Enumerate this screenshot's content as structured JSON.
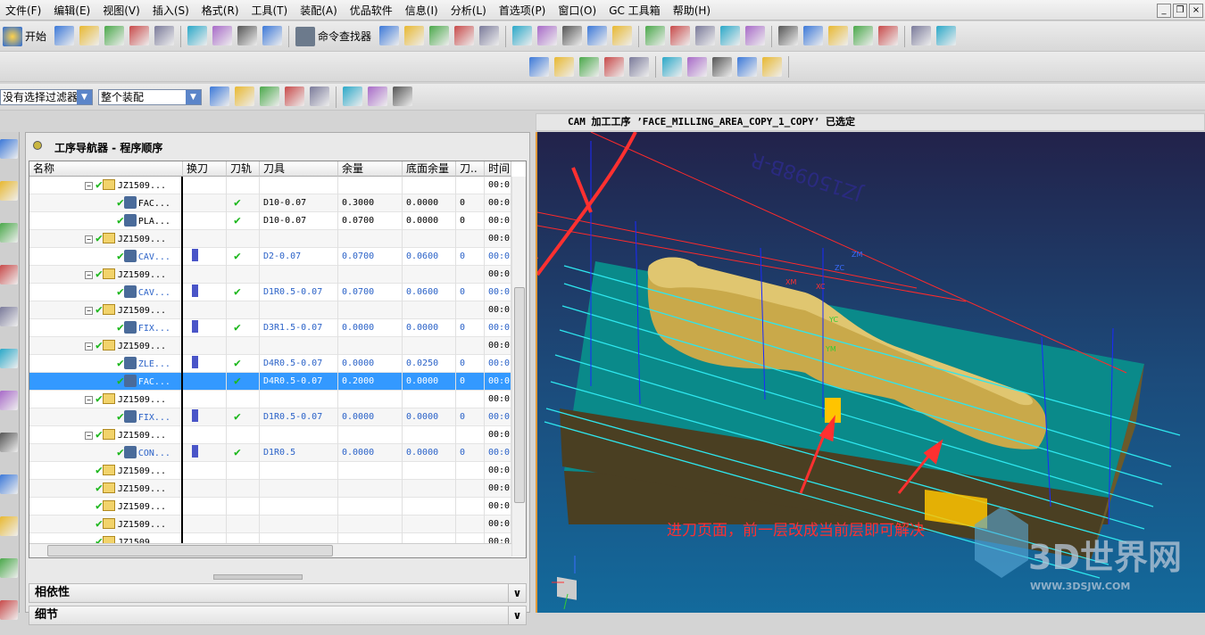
{
  "menu": [
    "文件(F)",
    "编辑(E)",
    "视图(V)",
    "插入(S)",
    "格式(R)",
    "工具(T)",
    "装配(A)",
    "优品软件",
    "信息(I)",
    "分析(L)",
    "首选项(P)",
    "窗口(O)",
    "GC 工具箱",
    "帮助(H)"
  ],
  "toolbar": {
    "start_label": "开始",
    "finder_label": "命令查找器",
    "row1_icons": [
      "new-icon",
      "open-icon",
      "save-icon",
      "print-icon",
      "cut-icon",
      "copy-icon",
      "paste-icon",
      "delete-icon",
      "undo-icon"
    ],
    "row1_right_icons": [
      "grid-icon",
      "view-icon",
      "verify-icon",
      "generate-icon",
      "postprocess-icon",
      "tool-icon",
      "geometry-icon",
      "method-icon",
      "path-icon",
      "curve-icon",
      "line-icon",
      "arc-icon",
      "point-icon",
      "shape-icon",
      "trim-icon",
      "offset-icon",
      "project-icon",
      "layer-icon",
      "check-icon",
      "list-icon",
      "table-icon",
      "display-icon"
    ],
    "row2_icons": [
      "info-icon",
      "tool-create-icon",
      "ops-icon",
      "cut-region-icon",
      "drive-icon",
      "boundary-icon",
      "pattern-icon",
      "wave-icon",
      "level-icon",
      "shop-doc-icon"
    ],
    "filter": {
      "selection_filter": "没有选择过滤器",
      "scope": "整个装配"
    },
    "row3_icons": [
      "snap-icon",
      "filter-icon",
      "select-target-icon",
      "undo-select-icon",
      "assembly-nav-icon",
      "rectangle-select-icon",
      "shaded-icon",
      "wireframe-box-icon"
    ]
  },
  "status": "CAM 加工工序 ’FACE_MILLING_AREA_COPY_1_COPY’ 已选定",
  "left_strip_icons": [
    "assembly-icon",
    "constraint-icon",
    "part-icon",
    "operation-nav-icon",
    "machine-icon",
    "reuse-icon",
    "palette-icon",
    "web-icon",
    "history-icon",
    "clock-icon",
    "roles-icon",
    "user-icon"
  ],
  "navigator": {
    "title": "工序导航器 - 程序顺序",
    "columns": [
      "名称",
      "换刀",
      "刀轨",
      "刀具",
      "余量",
      "底面余量",
      "刀..",
      "时间"
    ],
    "rows": [
      {
        "type": "group",
        "name": "JZ1509...",
        "time": "00:0",
        "expanded": true
      },
      {
        "type": "op",
        "name": "FAC...",
        "link": false,
        "toolchange": false,
        "path": true,
        "tool": "D10-0.07",
        "stock": "0.3000",
        "floor": "0.0000",
        "n": "0",
        "time": "00:0",
        "icon": "face-milling-icon"
      },
      {
        "type": "op",
        "name": "PLA...",
        "link": false,
        "toolchange": false,
        "path": true,
        "tool": "D10-0.07",
        "stock": "0.0700",
        "floor": "0.0000",
        "n": "0",
        "time": "00:0",
        "icon": "planar-mill-icon"
      },
      {
        "type": "group",
        "name": "JZ1509...",
        "time": "00:0",
        "expanded": true
      },
      {
        "type": "op",
        "name": "CAV...",
        "link": true,
        "toolchange": true,
        "path": true,
        "tool": "D2-0.07",
        "stock": "0.0700",
        "floor": "0.0600",
        "n": "0",
        "time": "00:0",
        "icon": "cavity-mill-icon"
      },
      {
        "type": "group",
        "name": "JZ1509...",
        "time": "00:0",
        "expanded": true
      },
      {
        "type": "op",
        "name": "CAV...",
        "link": true,
        "toolchange": true,
        "path": true,
        "tool": "D1R0.5-0.07",
        "stock": "0.0700",
        "floor": "0.0600",
        "n": "0",
        "time": "00:0",
        "icon": "cavity-mill-icon"
      },
      {
        "type": "group",
        "name": "JZ1509...",
        "time": "00:0",
        "expanded": true
      },
      {
        "type": "op",
        "name": "FIX...",
        "link": true,
        "toolchange": true,
        "path": true,
        "tool": "D3R1.5-0.07",
        "stock": "0.0000",
        "floor": "0.0000",
        "n": "0",
        "time": "00:0",
        "icon": "fixed-contour-icon"
      },
      {
        "type": "group",
        "name": "JZ1509...",
        "time": "00:0",
        "expanded": true
      },
      {
        "type": "op",
        "name": "ZLE...",
        "link": true,
        "toolchange": true,
        "path": true,
        "tool": "D4R0.5-0.07",
        "stock": "0.0000",
        "floor": "0.0250",
        "n": "0",
        "time": "00:0",
        "icon": "zlevel-icon"
      },
      {
        "type": "op",
        "name": "FAC...",
        "link": true,
        "toolchange": false,
        "path": true,
        "tool": "D4R0.5-0.07",
        "stock": "0.2000",
        "floor": "0.0000",
        "n": "0",
        "time": "00:0",
        "icon": "face-milling-icon",
        "selected": true
      },
      {
        "type": "group",
        "name": "JZ1509...",
        "time": "00:0",
        "expanded": true
      },
      {
        "type": "op",
        "name": "FIX...",
        "link": true,
        "toolchange": true,
        "path": true,
        "tool": "D1R0.5-0.07",
        "stock": "0.0000",
        "floor": "0.0000",
        "n": "0",
        "time": "00:0",
        "icon": "fixed-contour-icon"
      },
      {
        "type": "group",
        "name": "JZ1509...",
        "time": "00:0",
        "expanded": true
      },
      {
        "type": "op",
        "name": "CON...",
        "link": true,
        "toolchange": true,
        "path": true,
        "tool": "D1R0.5",
        "stock": "0.0000",
        "floor": "0.0000",
        "n": "0",
        "time": "00:0",
        "icon": "contour-icon"
      },
      {
        "type": "group",
        "name": "JZ1509...",
        "time": "00:0",
        "expanded": false
      },
      {
        "type": "group",
        "name": "JZ1509...",
        "time": "00:0",
        "expanded": false
      },
      {
        "type": "group",
        "name": "JZ1509...",
        "time": "00:0",
        "expanded": false
      },
      {
        "type": "group",
        "name": "JZ1509...",
        "time": "00:0",
        "expanded": false
      },
      {
        "type": "group",
        "name": "JZ1509...",
        "time": "00:0",
        "expanded": false
      }
    ],
    "panels": [
      "相依性",
      "细节"
    ]
  },
  "viewport": {
    "part_label": "JZ15098B-R",
    "axis_labels": {
      "zm": "ZM",
      "zc": "ZC",
      "xm": "XM",
      "xc": "XC",
      "yc": "YC",
      "ym": "YM"
    },
    "annotation": "进刀页面，前一层改成当前层即可解决",
    "watermark": {
      "brand": "3D世界网",
      "url": "WWW.3DSJW.COM"
    },
    "colors": {
      "part": "#e0c670",
      "floor": "#0a8a8a",
      "base": "#4a3f22",
      "toolpath": "#2ee6ee",
      "annotation": "#ff3030"
    }
  }
}
